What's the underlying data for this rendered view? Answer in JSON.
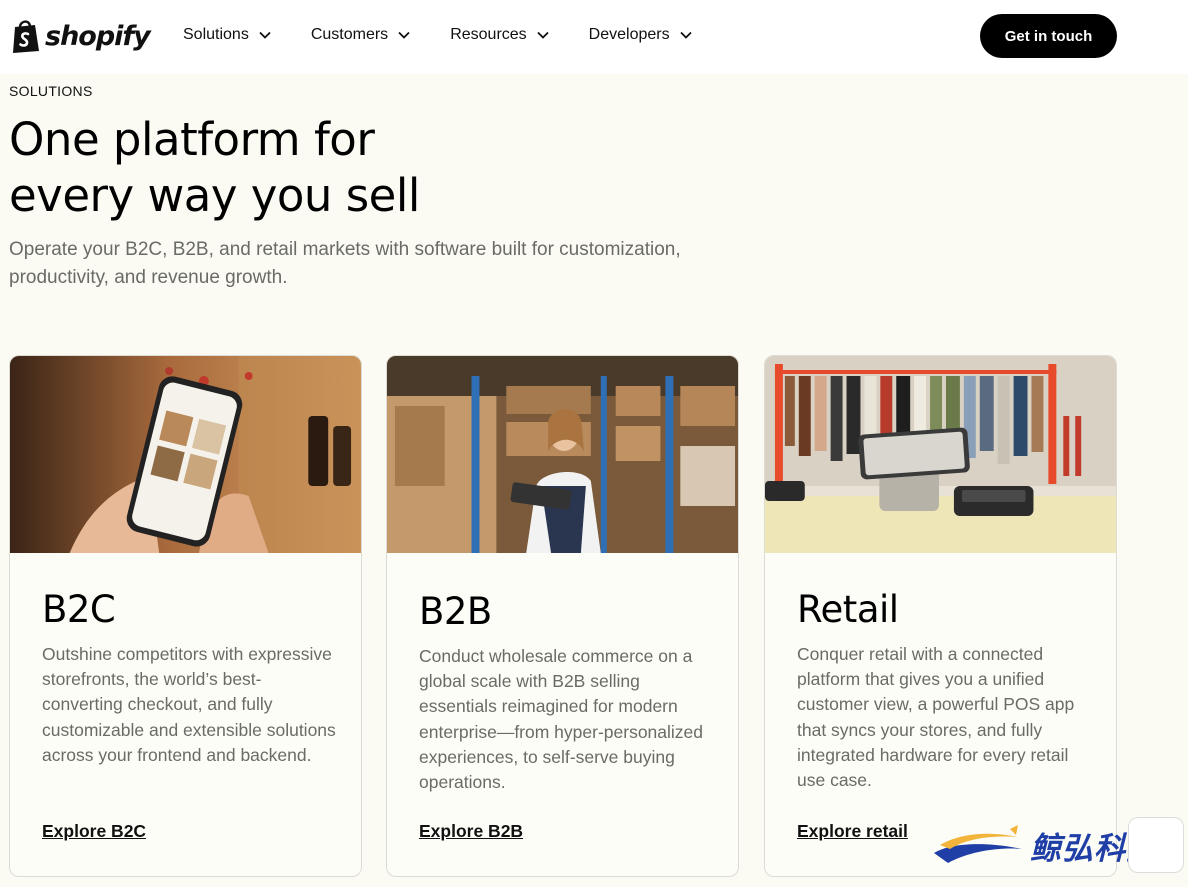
{
  "nav": {
    "logo_text": "shopify",
    "items": [
      {
        "label": "Solutions"
      },
      {
        "label": "Customers"
      },
      {
        "label": "Resources"
      },
      {
        "label": "Developers"
      }
    ],
    "cta_label": "Get in touch"
  },
  "hero": {
    "eyebrow": "SOLUTIONS",
    "headline_line1": "One platform for",
    "headline_line2": "every way you sell",
    "subheading": "Operate your B2C, B2B, and retail markets with software built for customization, productivity, and revenue growth."
  },
  "cards": [
    {
      "title": "B2C",
      "description": "Outshine competitors with expressive storefronts, the world’s best-converting checkout, and fully customizable and extensible solutions across your frontend and backend.",
      "link": "Explore B2C",
      "image_icon": "phone-shopping-photo"
    },
    {
      "title": "B2B",
      "description": "Conduct wholesale commerce on a global scale with B2B selling essentials reimagined for modern enterprise—from hyper-personalized experiences, to self-serve buying operations.",
      "link": "Explore B2B",
      "image_icon": "warehouse-photo"
    },
    {
      "title": "Retail",
      "description": "Conquer retail with a connected platform that gives you a unified customer view, a powerful POS app that syncs your stores, and fully integrated hardware for every retail use case.",
      "link": "Explore retail",
      "image_icon": "retail-pos-photo"
    }
  ],
  "watermark": {
    "text": "鲸弘科技"
  },
  "colors": {
    "background": "#fbfbf4",
    "nav_bg": "#ffffff",
    "cta_bg": "#000000",
    "muted_text": "#6b6b66",
    "logo_green": "#000000"
  }
}
